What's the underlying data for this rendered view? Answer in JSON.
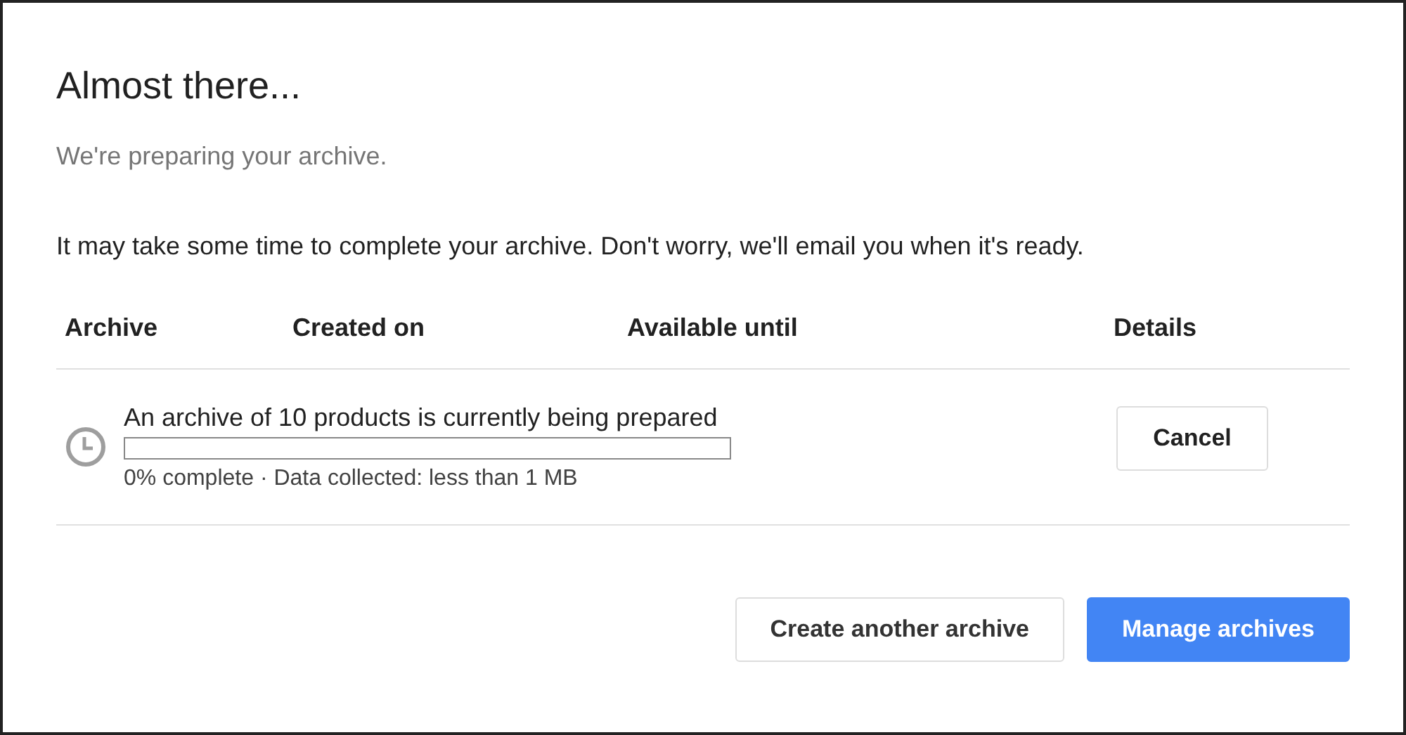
{
  "dialog": {
    "title": "Almost there...",
    "subtitle": "We're preparing your archive.",
    "message": "It may take some time to complete your archive. Don't worry, we'll email you when it's ready."
  },
  "table": {
    "columns": [
      "Archive",
      "Created on",
      "Available until",
      "Details"
    ],
    "rows": [
      {
        "title": "An archive of 10 products is currently being prepared",
        "level": 0,
        "status": "0% complete · Data collected: less than 1 MB",
        "action": "Cancel"
      }
    ]
  },
  "buttons": [
    {
      "label": "Create another archive",
      "kind": "secondary"
    },
    {
      "label": "Manage archives",
      "kind": "primary"
    }
  ]
}
